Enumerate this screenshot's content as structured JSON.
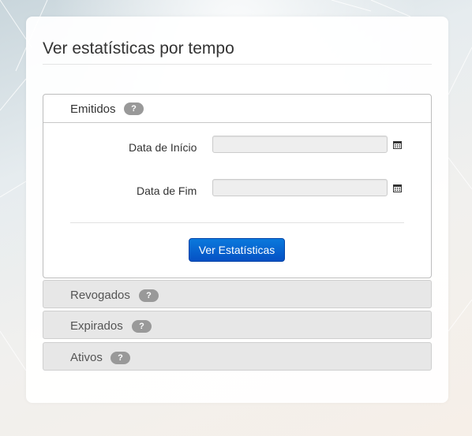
{
  "page": {
    "title": "Ver estatísticas por tempo"
  },
  "sections": [
    {
      "label": "Emitidos",
      "help": "?",
      "expanded": true
    },
    {
      "label": "Revogados",
      "help": "?",
      "expanded": false
    },
    {
      "label": "Expirados",
      "help": "?",
      "expanded": false
    },
    {
      "label": "Ativos",
      "help": "?",
      "expanded": false
    }
  ],
  "form": {
    "start_label": "Data de Início",
    "start_value": "",
    "end_label": "Data de Fim",
    "end_value": "",
    "submit_label": "Ver Estatísticas"
  },
  "colors": {
    "primary": "#0a66d0",
    "badge": "#999999",
    "collapsed": "#e7e7e7"
  },
  "icons": {
    "date_picker": "calendar-icon"
  }
}
